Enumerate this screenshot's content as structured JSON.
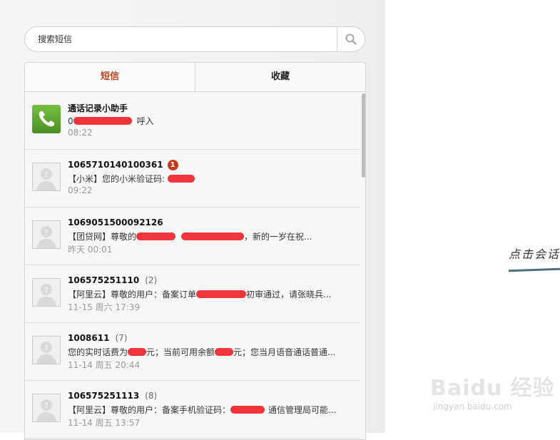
{
  "search": {
    "placeholder": "搜索短信",
    "icon": "search-icon"
  },
  "tabs": [
    {
      "label": "短信",
      "active": true
    },
    {
      "label": "收藏",
      "active": false
    }
  ],
  "messages": [
    {
      "sender": "通话记录小助手",
      "count": "",
      "badge": "",
      "preview_prefix": "0",
      "preview_suffix": "呼入",
      "time": "08:22",
      "avatar": "phone-icon"
    },
    {
      "sender": "1065710140100361",
      "count": "",
      "badge": "1",
      "preview_prefix": "【小米】您的小米验证码: ",
      "preview_suffix": "",
      "time": "09:22",
      "avatar": "default-avatar-icon"
    },
    {
      "sender": "1069051500092126",
      "count": "",
      "badge": "",
      "preview_prefix": "【团贷网】尊敬的",
      "preview_suffix": "，新的一岁在祝...",
      "time": "昨天 00:01",
      "avatar": "default-avatar-icon"
    },
    {
      "sender": "106575251110",
      "count": "(2)",
      "badge": "",
      "preview_prefix": "【阿里云】尊敬的用户：备案订单",
      "preview_suffix": "初审通过，请张晓兵...",
      "time": "11-15 周六 17:39",
      "avatar": "default-avatar-icon"
    },
    {
      "sender": "1008611",
      "count": "(7)",
      "badge": "",
      "preview_prefix": "您的实时话费为",
      "preview_middle": "元；当前可用余额",
      "preview_suffix": "元；您当月语音通话普通...",
      "time": "11-14 周五 20:44",
      "avatar": "default-avatar-icon"
    },
    {
      "sender": "106575251113",
      "count": "(8)",
      "badge": "",
      "preview_prefix": "【阿里云】尊敬的用户：备案手机验证码：",
      "preview_suffix": "通信管理局可能...",
      "time": "11-14 周五 13:57",
      "avatar": "default-avatar-icon"
    }
  ],
  "annotation": {
    "text": "点击会话"
  },
  "watermark": {
    "main": "Baidu 经验",
    "sub": "jingyan.baidu.com"
  },
  "colors": {
    "active_tab": "#b6461e",
    "badge": "#c43a1d",
    "redaction": "#f0353a",
    "phone_icon_bg": "#5ba02c"
  }
}
